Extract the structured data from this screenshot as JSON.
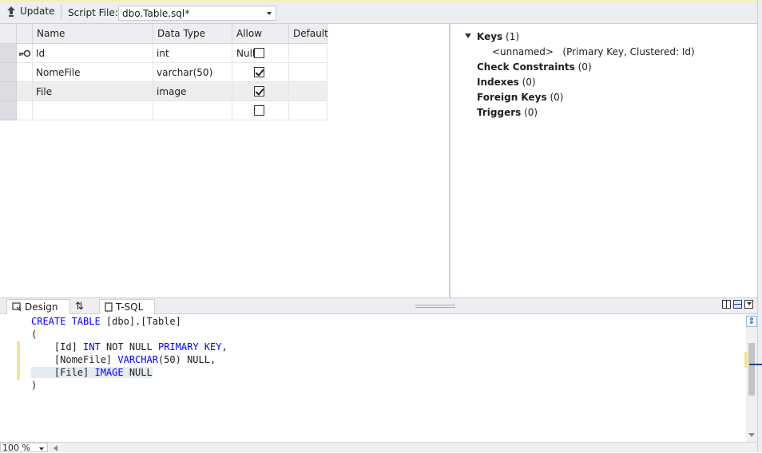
{
  "toolbar": {
    "update_label": "Update",
    "script_file_label": "Script File:",
    "script_file_value": "dbo.Table.sql*"
  },
  "grid": {
    "columns": [
      "Name",
      "Data Type",
      "Allow Nulls",
      "Default"
    ],
    "rows": [
      {
        "name": "Id",
        "type": "int",
        "allow_nulls": false,
        "primary_key": true
      },
      {
        "name": "NomeFile",
        "type": "varchar(50)",
        "allow_nulls": true,
        "primary_key": false
      },
      {
        "name": "File",
        "type": "image",
        "allow_nulls": true,
        "primary_key": false
      },
      {
        "name": "",
        "type": "",
        "allow_nulls": false,
        "primary_key": false
      }
    ]
  },
  "properties": {
    "keys": {
      "label": "Keys",
      "count": "(1)"
    },
    "key_item": {
      "name": "<unnamed>",
      "detail": "(Primary Key, Clustered: Id)"
    },
    "check_constraints": {
      "label": "Check Constraints",
      "count": "(0)"
    },
    "indexes": {
      "label": "Indexes",
      "count": "(0)"
    },
    "foreign_keys": {
      "label": "Foreign Keys",
      "count": "(0)"
    },
    "triggers": {
      "label": "Triggers",
      "count": "(0)"
    }
  },
  "tabs": {
    "design": "Design",
    "swap": "⇅",
    "tsql": "T-SQL"
  },
  "editor": {
    "l1a": "CREATE TABLE",
    "l1b": " [dbo].[Table]",
    "l2": "(",
    "l3a": "    [Id] ",
    "l3b": "INT",
    "l3c": " NOT NULL ",
    "l3d": "PRIMARY KEY",
    "l3e": ",",
    "l4a": "    [NomeFile] ",
    "l4b": "VARCHAR",
    "l4c": "(50) NULL,",
    "l5a": "    [File] ",
    "l5b": "IMAGE",
    "l5c": " NULL",
    "l6": ")"
  },
  "status": {
    "zoom": "100 %"
  },
  "icons": {
    "update": "up-arrow-icon",
    "key": "key-icon",
    "design": "design-icon"
  }
}
